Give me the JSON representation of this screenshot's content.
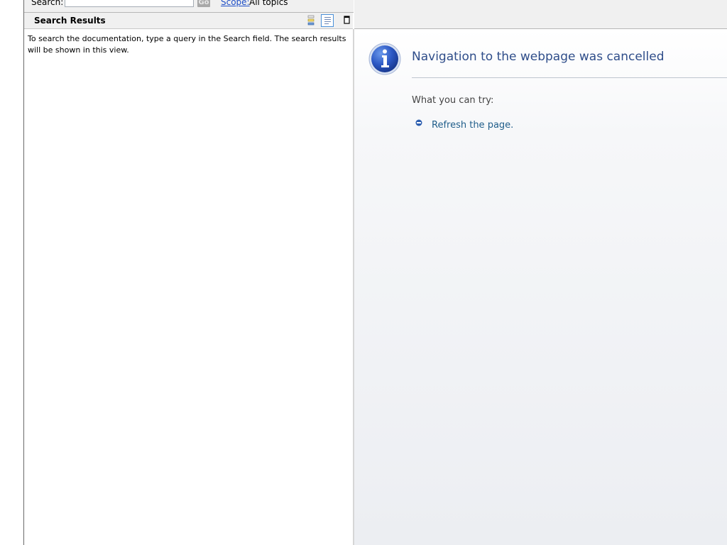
{
  "search": {
    "label": "Search:",
    "input_value": "",
    "go_label": "Go",
    "scope_label": "Scope:",
    "scope_value": "All topics"
  },
  "results": {
    "title": "Search Results",
    "message": "To search the documentation, type a query in the Search field. The search results will be shown in this view."
  },
  "navigation": {
    "title": "Navigation to the webpage was cancelled",
    "try_label": "What you can try:",
    "refresh_label": "Refresh the page."
  },
  "colors": {
    "title_blue": "#2f4d8a",
    "link_blue": "#1f5d8a",
    "scope_link": "#1f4fc7"
  },
  "icons": {
    "results_list": "list-view-icon",
    "results_detail": "detail-view-icon",
    "minimize": "minimize-icon",
    "info": "info-icon",
    "bullet": "bullet-icon"
  }
}
